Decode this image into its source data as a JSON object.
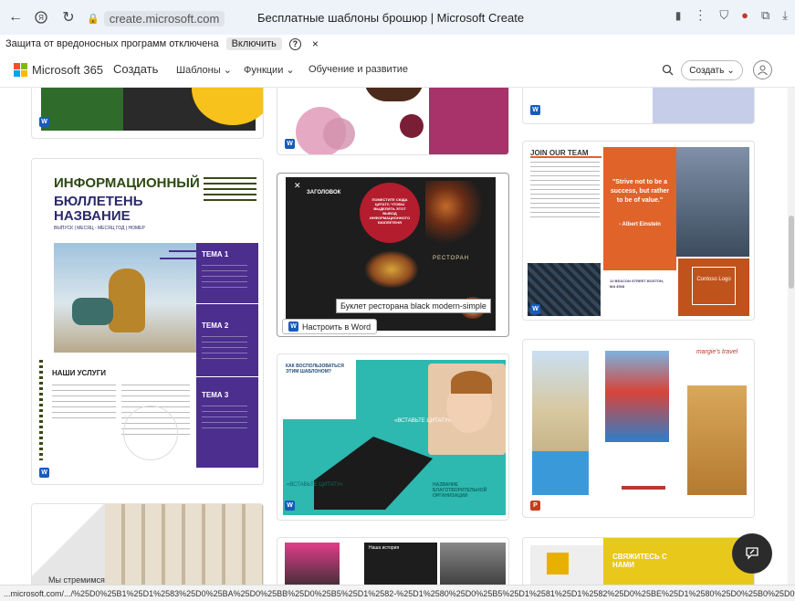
{
  "browser": {
    "url": "create.microsoft.com",
    "tab_title": "Бесплатные шаблоны брошюр | Microsoft Create"
  },
  "warning_bar": {
    "text": "Защита от вредоносных программ отключена",
    "enable_label": "Включить",
    "help": "?",
    "close": "×"
  },
  "header": {
    "brand": "Microsoft 365",
    "create_link": "Создать",
    "nav": [
      {
        "label": "Шаблоны"
      },
      {
        "label": "Функции"
      },
      {
        "label": "Обучение и развитие"
      }
    ],
    "create_button": "Создать"
  },
  "newsletter": {
    "title_line1": "ИНФОРМАЦИОННЫЙ",
    "title_line2": "БЮЛЛЕТЕНЬ",
    "title_line3": "НАЗВАНИЕ",
    "subtitle": "ВЫПУСК | МЕСЯЦ - МЕСЯЦ ГОД | НОМЕР",
    "services": "НАШИ УСЛУГИ",
    "tema1": "ТЕМА 1",
    "tema2": "ТЕМА 2",
    "tema3": "ТЕМА 3"
  },
  "restaurant": {
    "header": "ЗАГОЛОВОК",
    "circle_text": "ПОМЕСТИТЕ СЮДА ЦИТАТУ, ЧТОБЫ ВЫДЕЛИТЬ ЭТОТ ВЫВОД ИНФОРМАЦИОННОГО БЮЛЛЕТЕНЯ",
    "logo": "РЕСТОРАН",
    "tooltip": "Буклет ресторана black modern-simple",
    "open_label": "Настроить в Word"
  },
  "join_team": {
    "title": "JOIN OUR TEAM",
    "quote": "\"Strive not to be a success, but rather to be of value.\"",
    "author": "- Albert Einstein",
    "address": "12 BEACON STREET BOSTON, MA 4568",
    "logo": "Contoso Logo"
  },
  "kids": {
    "title": "КАК ВОСПОЛЬЗОВАТЬСЯ ЭТИМ ШАБЛОНОМ?",
    "quote1": "«ВСТАВЬТЕ ЦИТАТУ»",
    "quote2": "«ВСТАВЬТЕ ЦИТАТУ»",
    "org": "НАЗВАНИЕ БЛАГОТВОРИТЕЛЬНОЙ ОРГАНИЗАЦИИ"
  },
  "travel": {
    "brand": "margie's travel"
  },
  "bottom": {
    "column_text": "Мы стремимся",
    "history": "Наша история",
    "join_us": "СВЯЖИТЕСЬ С НАМИ"
  },
  "status_url": "...microsoft.com/.../%25D0%25B1%25D1%2583%25D0%25BA%25D0%25BB%25D0%25B5%25D1%2582-%25D1%2580%25D0%25B5%25D1%2581%25D1%2582%25D0%25BE%25D1%2580%25D0%25B0%25D0%25BD%25D0%25B0-9fd05068-..."
}
